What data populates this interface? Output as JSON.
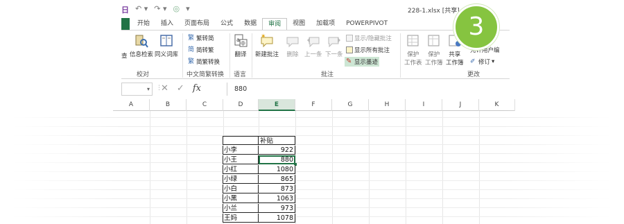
{
  "window": {
    "title": "228-1.xlsx  [共享] - Excel",
    "qat": {
      "app_mark": "日",
      "undo": "↶ ▾",
      "redo": "↷ ▾",
      "touch": "◎",
      "customize": "▾"
    }
  },
  "tabs": [
    {
      "label": "开始"
    },
    {
      "label": "插入"
    },
    {
      "label": "页面布局"
    },
    {
      "label": "公式"
    },
    {
      "label": "数据"
    },
    {
      "label": "审阅"
    },
    {
      "label": "视图"
    },
    {
      "label": "加载项"
    },
    {
      "label": "POWERPIVOT"
    }
  ],
  "ribbon": {
    "proofing": {
      "label": "校对",
      "research": "信息检索",
      "thesaurus": "同义词库",
      "stub": "查"
    },
    "chinese": {
      "label": "中文简繁转换",
      "t2s": "繁转简",
      "s2t": "简转繁",
      "convert": "简繁转换"
    },
    "language": {
      "label": "语言",
      "translate": "翻译"
    },
    "comments": {
      "label": "批注",
      "new": "新建批注",
      "delete": "删除",
      "prev": "上一条",
      "next": "下一条",
      "toggle": "显示/隐藏批注",
      "show_all": "显示所有批注",
      "ink": "显示墨迹"
    },
    "changes": {
      "label": "更改",
      "protect_sheet": [
        "保护",
        "工作表"
      ],
      "protect_book": [
        "保护",
        "工作簿"
      ],
      "share": [
        "共享",
        "工作簿"
      ],
      "allow_edit": "允许用户编",
      "track": "修订",
      "protect_share_stub": "共享"
    }
  },
  "formula_bar": {
    "name_box": "",
    "cancel": "✕",
    "enter": "✓",
    "fx": "fx",
    "value": "880"
  },
  "columns": [
    "A",
    "B",
    "C",
    "D",
    "E",
    "F",
    "G",
    "H",
    "I",
    "J",
    "K"
  ],
  "selected_column": "E",
  "table": {
    "header": "补贴",
    "rows": [
      {
        "name": "小李",
        "value": "922"
      },
      {
        "name": "小王",
        "value": "880"
      },
      {
        "name": "小红",
        "value": "1080"
      },
      {
        "name": "小绿",
        "value": "865"
      },
      {
        "name": "小白",
        "value": "873"
      },
      {
        "name": "小黑",
        "value": "1063"
      },
      {
        "name": "小兰",
        "value": "973"
      },
      {
        "name": "王妈",
        "value": "1078"
      }
    ]
  },
  "step_badge": "3",
  "colors": {
    "excel_green": "#217346",
    "badge_green": "#86c440",
    "highlight": "#cde6d4"
  }
}
